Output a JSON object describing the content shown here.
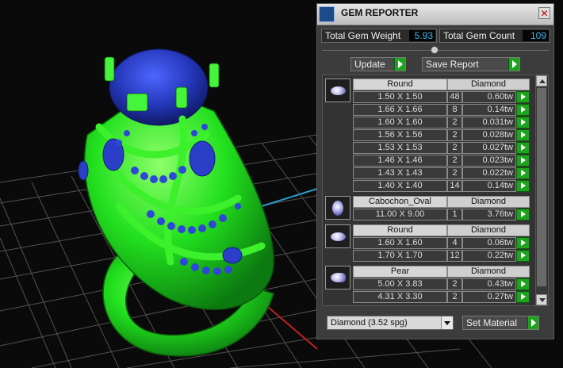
{
  "panel": {
    "title": "GEM REPORTER",
    "close_label": "✕",
    "total_weight_label": "Total Gem Weight",
    "total_weight_value": "5.93",
    "total_count_label": "Total Gem Count",
    "total_count_value": "109",
    "update_label": "Update",
    "save_report_label": "Save Report",
    "material_value": "Diamond    (3.52 spg)",
    "set_material_label": "Set Material"
  },
  "groups": [
    {
      "shape": "Round",
      "material": "Diamond",
      "icon": "round-gem-icon",
      "rows": [
        {
          "size": "1.50 X 1.50",
          "count": "48",
          "weight": "0.60tw"
        },
        {
          "size": "1.66 X 1.66",
          "count": "8",
          "weight": "0.14tw"
        },
        {
          "size": "1.60 X 1.60",
          "count": "2",
          "weight": "0.031tw"
        },
        {
          "size": "1.56 X 1.56",
          "count": "2",
          "weight": "0.028tw"
        },
        {
          "size": "1.53 X 1.53",
          "count": "2",
          "weight": "0.027tw"
        },
        {
          "size": "1.46 X 1.46",
          "count": "2",
          "weight": "0.023tw"
        },
        {
          "size": "1.43 X 1.43",
          "count": "2",
          "weight": "0.022tw"
        },
        {
          "size": "1.40 X 1.40",
          "count": "14",
          "weight": "0.14tw"
        }
      ]
    },
    {
      "shape": "Cabochon_Oval",
      "material": "Diamond",
      "icon": "cabochon-gem-icon",
      "rows": [
        {
          "size": "11.00 X 9.00",
          "count": "1",
          "weight": "3.76tw"
        }
      ]
    },
    {
      "shape": "Round",
      "material": "Diamond",
      "icon": "round-gem-icon",
      "rows": [
        {
          "size": "1.60 X 1.60",
          "count": "4",
          "weight": "0.06tw"
        },
        {
          "size": "1.70 X 1.70",
          "count": "12",
          "weight": "0.22tw"
        }
      ]
    },
    {
      "shape": "Pear",
      "material": "Diamond",
      "icon": "pear-gem-icon",
      "rows": [
        {
          "size": "5.00 X 3.83",
          "count": "2",
          "weight": "0.43tw"
        },
        {
          "size": "4.31 X 3.30",
          "count": "2",
          "weight": "0.27tw"
        }
      ]
    }
  ],
  "colors": {
    "model": "#22e01e",
    "gems": "#2b3ec8",
    "grid": "#5a5a5a",
    "accent_button": "#1fa31f"
  }
}
